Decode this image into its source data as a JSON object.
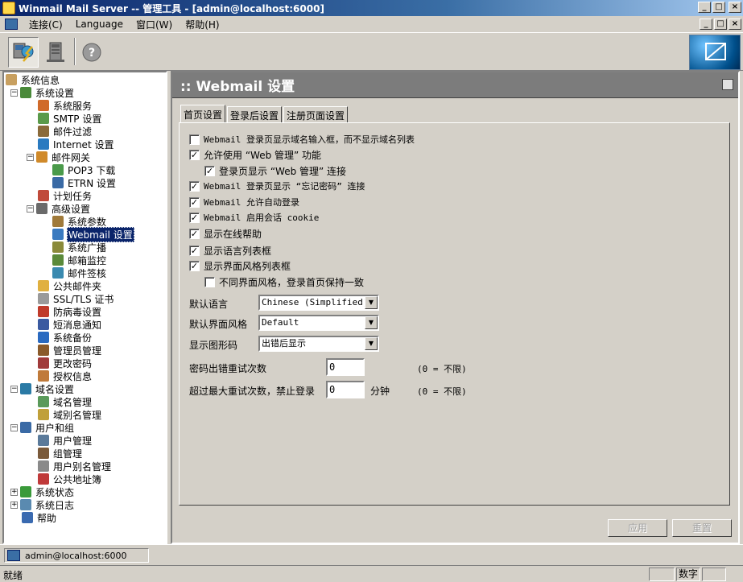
{
  "window": {
    "title": "Winmail Mail Server -- 管理工具 - [admin@localhost:6000]",
    "minimize": "_",
    "maximize": "□",
    "close": "×"
  },
  "menu": {
    "items": [
      "连接(C)",
      "Language",
      "窗口(W)",
      "帮助(H)"
    ]
  },
  "toolbar": {
    "icons": [
      "connect-icon",
      "disconnect-icon",
      "help-icon"
    ],
    "help_glyph": "?"
  },
  "tree": {
    "items": [
      {
        "label": "系统信息",
        "icon": "info-icon",
        "color": "#c8a060"
      },
      {
        "label": "系统设置",
        "icon": "settings-icon",
        "color": "#4a8a3a",
        "expander": "−"
      },
      {
        "label": "系统服务",
        "icon": "service-icon",
        "color": "#d06a2a"
      },
      {
        "label": "SMTP 设置",
        "icon": "smtp-icon",
        "color": "#5a9a4a"
      },
      {
        "label": "邮件过滤",
        "icon": "filter-icon",
        "color": "#8a6a3a"
      },
      {
        "label": "Internet 设置",
        "icon": "internet-icon",
        "color": "#2a7ac0"
      },
      {
        "label": "邮件网关",
        "icon": "gateway-icon",
        "color": "#d08a2a",
        "expander": "−"
      },
      {
        "label": "POP3 下载",
        "icon": "pop3-icon",
        "color": "#4a9a4a"
      },
      {
        "label": "ETRN 设置",
        "icon": "etrn-icon",
        "color": "#3a6aa5"
      },
      {
        "label": "计划任务",
        "icon": "task-icon",
        "color": "#c04a3a"
      },
      {
        "label": "高级设置",
        "icon": "advanced-icon",
        "color": "#6a6a6a",
        "expander": "−"
      },
      {
        "label": "系统参数",
        "icon": "params-icon",
        "color": "#a07a3a"
      },
      {
        "label": "Webmail 设置",
        "icon": "webmail-icon",
        "color": "#3a7ac0",
        "selected": true
      },
      {
        "label": "系统广播",
        "icon": "broadcast-icon",
        "color": "#8a8a3a"
      },
      {
        "label": "邮箱监控",
        "icon": "monitor-icon",
        "color": "#5a8a3a"
      },
      {
        "label": "邮件签核",
        "icon": "sign-icon",
        "color": "#3a8ab0"
      },
      {
        "label": "公共邮件夹",
        "icon": "folder-icon",
        "color": "#e0b040"
      },
      {
        "label": "SSL/TLS 证书",
        "icon": "cert-icon",
        "color": "#9a9a9a"
      },
      {
        "label": "防病毒设置",
        "icon": "antivirus-icon",
        "color": "#c03a2a"
      },
      {
        "label": "短消息通知",
        "icon": "sms-icon",
        "color": "#3a5aa0"
      },
      {
        "label": "系统备份",
        "icon": "backup-icon",
        "color": "#2a6ac0"
      },
      {
        "label": "管理员管理",
        "icon": "admin-icon",
        "color": "#8a5a2a"
      },
      {
        "label": "更改密码",
        "icon": "password-icon",
        "color": "#a03a3a"
      },
      {
        "label": "授权信息",
        "icon": "license-icon",
        "color": "#c07a3a"
      },
      {
        "label": "域名设置",
        "icon": "domain-icon",
        "color": "#2a7aa5",
        "expander": "−"
      },
      {
        "label": "域名管理",
        "icon": "domain-manage-icon",
        "color": "#5a9a5a"
      },
      {
        "label": "域别名管理",
        "icon": "domain-alias-icon",
        "color": "#c0a03a"
      },
      {
        "label": "用户和组",
        "icon": "users-icon",
        "color": "#3a6aa5",
        "expander": "−"
      },
      {
        "label": "用户管理",
        "icon": "user-icon",
        "color": "#5a7a9a"
      },
      {
        "label": "组管理",
        "icon": "group-icon",
        "color": "#7a5a3a"
      },
      {
        "label": "用户别名管理",
        "icon": "user-alias-icon",
        "color": "#8a8a8a"
      },
      {
        "label": "公共地址簿",
        "icon": "addressbook-icon",
        "color": "#c03a3a"
      },
      {
        "label": "系统状态",
        "icon": "status-icon",
        "color": "#3a9a3a",
        "expander": "+"
      },
      {
        "label": "系统日志",
        "icon": "log-icon",
        "color": "#5a8ab0",
        "expander": "+"
      },
      {
        "label": "帮助",
        "icon": "help-book-icon",
        "color": "#3a6ab0"
      }
    ]
  },
  "content": {
    "title": ":: Webmail 设置",
    "tabs": [
      "首页设置",
      "登录后设置",
      "注册页面设置"
    ],
    "checkboxes": [
      {
        "label": "Webmail 登录页显示域名输入框，而不显示域名列表",
        "checked": false
      },
      {
        "label": "允许使用 “Web 管理” 功能",
        "checked": true
      },
      {
        "label": "登录页显示 “Web 管理” 连接",
        "checked": true
      },
      {
        "label": "Webmail 登录页显示 “忘记密码” 连接",
        "checked": true
      },
      {
        "label": "Webmail 允许自动登录",
        "checked": true
      },
      {
        "label": "Webmail 启用会话 cookie",
        "checked": true
      },
      {
        "label": "显示在线帮助",
        "checked": true
      },
      {
        "label": "显示语言列表框",
        "checked": true
      },
      {
        "label": "显示界面风格列表框",
        "checked": true
      },
      {
        "label": "不同界面风格，登录首页保持一致",
        "checked": false
      }
    ],
    "check_glyph": "✓",
    "default_language_label": "默认语言",
    "default_language_value": "Chinese (Simplified)",
    "default_style_label": "默认界面风格",
    "default_style_value": "Default",
    "captcha_label": "显示图形码",
    "captcha_value": "出错后显示",
    "select_arrow": "▼",
    "pwd_retry_label": "密码出错重试次数",
    "pwd_retry_value": "0",
    "pwd_retry_hint": "(0 = 不限)",
    "lock_label": "超过最大重试次数，禁止登录",
    "lock_value": "0",
    "lock_unit": "分钟",
    "lock_hint": "(0 = 不限)",
    "apply_button": "应用",
    "reset_button": "重置"
  },
  "connection": {
    "label": "admin@localhost:6000"
  },
  "status": {
    "text": "就绪",
    "num_indicator": "数字"
  }
}
